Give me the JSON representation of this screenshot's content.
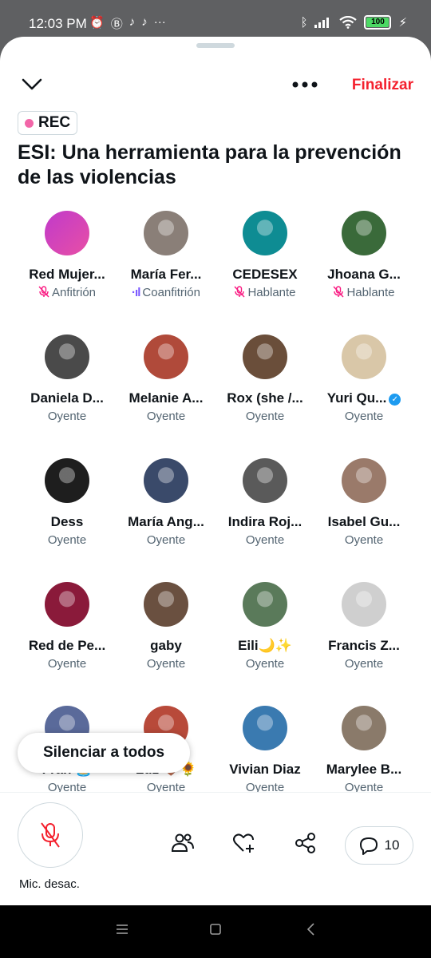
{
  "status": {
    "time": "12:03 PM",
    "battery": "100"
  },
  "header": {
    "finalize_label": "Finalizar",
    "rec_label": "REC",
    "title": "ESI: Una herramienta para la prevención de las violencias"
  },
  "participants": [
    {
      "name": "Red Mujer...",
      "role": "Anfitrión",
      "role_icon": "mic-off-icon",
      "avatar_color": "#ffffff"
    },
    {
      "name": "María Fer...",
      "role": "Coanfitrión",
      "role_icon": "speaking-icon",
      "avatar_color": "#8a7f78"
    },
    {
      "name": "CEDESEX",
      "role": "Hablante",
      "role_icon": "mic-off-icon",
      "avatar_color": "#0e8c93"
    },
    {
      "name": "Jhoana G...",
      "role": "Hablante",
      "role_icon": "mic-off-icon",
      "avatar_color": "#3a6a3a"
    },
    {
      "name": "Daniela D...",
      "role": "Oyente",
      "avatar_color": "#4a4a4a"
    },
    {
      "name": "Melanie A...",
      "role": "Oyente",
      "avatar_color": "#b04a3a"
    },
    {
      "name": "Rox (she /...",
      "role": "Oyente",
      "avatar_color": "#6a4e3a"
    },
    {
      "name": "Yuri Qu...",
      "role": "Oyente",
      "verified": true,
      "avatar_color": "#d9c7a8"
    },
    {
      "name": "Dess",
      "role": "Oyente",
      "avatar_color": "#1e1e1e"
    },
    {
      "name": "María Ang...",
      "role": "Oyente",
      "avatar_color": "#3a4a6a"
    },
    {
      "name": "Indira Roj...",
      "role": "Oyente",
      "avatar_color": "#5a5a5a"
    },
    {
      "name": "Isabel Gu...",
      "role": "Oyente",
      "avatar_color": "#9a7a6a"
    },
    {
      "name": "Red de Pe...",
      "role": "Oyente",
      "avatar_color": "#8a1a3a"
    },
    {
      "name": "gaby",
      "role": "Oyente",
      "avatar_color": "#6a5040"
    },
    {
      "name": "Eili🌙✨",
      "role": "Oyente",
      "avatar_color": "#5a7a5a"
    },
    {
      "name": "Francis Z...",
      "role": "Oyente",
      "avatar_color": "#cfcfcf"
    },
    {
      "name": "Fran 🏝️",
      "role": "Oyente",
      "avatar_color": "#5a6a9a"
    },
    {
      "name": "Luz 🤎🌻",
      "role": "Oyente",
      "avatar_color": "#b84a3a"
    },
    {
      "name": "Vivian Diaz",
      "role": "Oyente",
      "avatar_color": "#3a7ab0"
    },
    {
      "name": "Marylee B...",
      "role": "Oyente",
      "avatar_color": "#8a7a6a"
    }
  ],
  "mute_all_label": "Silenciar a todos",
  "bottom": {
    "mic_label": "Mic. desac.",
    "reply_count": "10"
  },
  "colors": {
    "accent_red": "#f4212e",
    "rec_dot": "#f266a8",
    "muted_mic": "#f91880",
    "speaking": "#7856ff",
    "verified": "#1d9bf0"
  }
}
